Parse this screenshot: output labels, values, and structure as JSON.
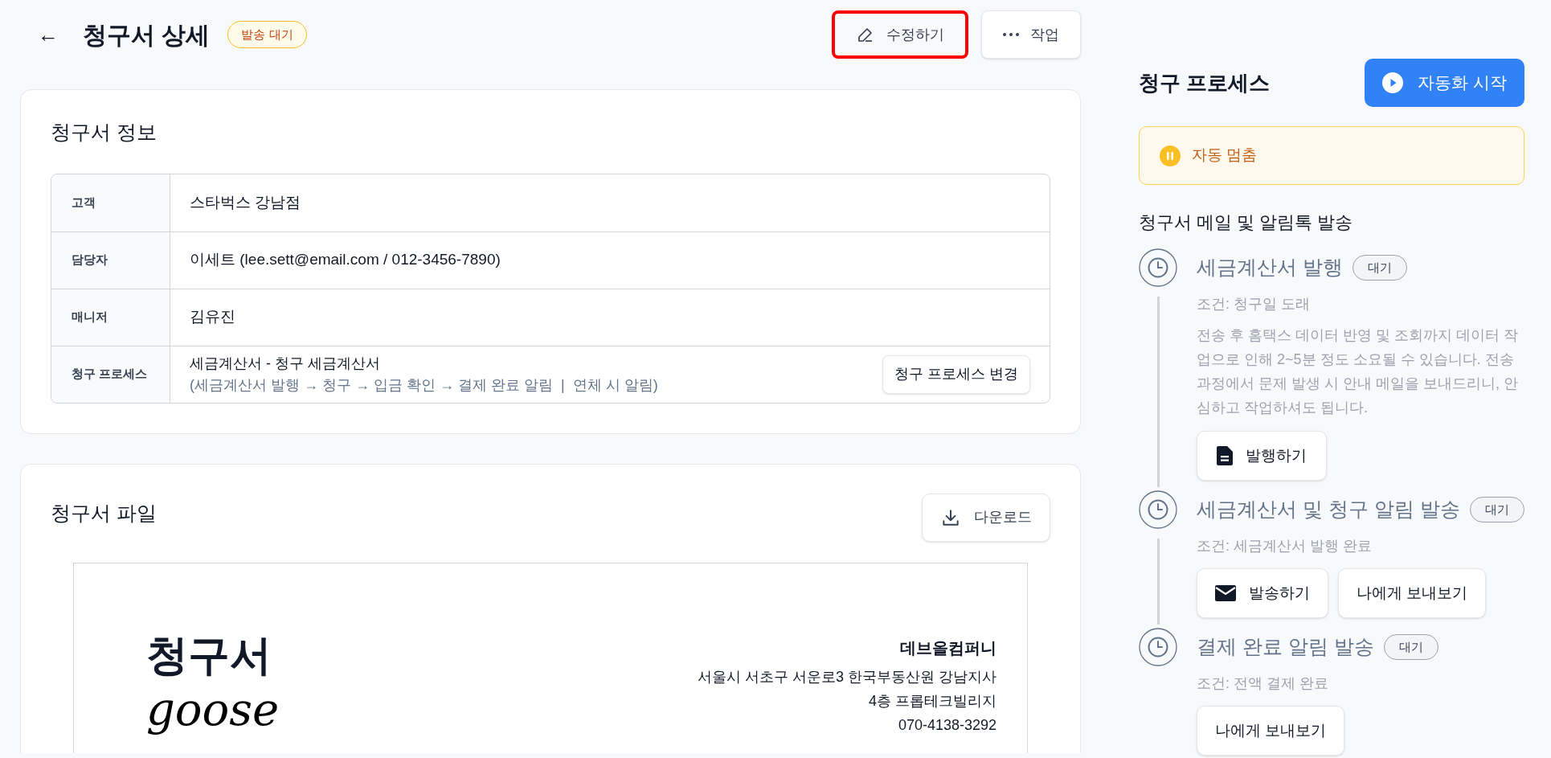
{
  "header": {
    "back": "←",
    "title": "청구서 상세",
    "status_badge": "발송 대기",
    "actions": [
      {
        "label": "수정하기",
        "kind": "edit",
        "highlighted": true
      },
      {
        "label": "작업",
        "kind": "more",
        "highlighted": false
      }
    ]
  },
  "invoice_info": {
    "title": "청구서 정보",
    "rows": [
      {
        "label": "고객",
        "value": "스타벅스 강남점"
      },
      {
        "label": "담당자",
        "value": "이세트 (lee.sett@email.com / 012-3456-7890)"
      },
      {
        "label": "매니저",
        "value": "김유진"
      },
      {
        "label": "청구 프로세스",
        "value": "세금계산서 - 청구 세금계산서",
        "detail": "(세금계산서 발행 → 청구 → 입금 확인 → 결제 완료 알림  |  연체 시 알림)",
        "button": "청구 프로세스 변경"
      }
    ]
  },
  "invoice_file": {
    "title": "청구서 파일",
    "download": "다운로드",
    "document": {
      "heading": "청구서",
      "logo": "goose",
      "company": "데브올컴퍼니",
      "address_lines": [
        "서울시 서초구 서운로3 한국부동산원 강남지사",
        "4층 프롭테크빌리지",
        "070-4138-3292"
      ]
    }
  },
  "process": {
    "title": "청구 프로세스",
    "start_button": "자동화 시작",
    "status": "자동 멈춤",
    "section_title": "청구서 메일 및 알림톡 발송",
    "steps": [
      {
        "title": "세금계산서 발행",
        "badge": "대기",
        "condition": "조건: 청구일 도래",
        "description": "전송 후 홈택스 데이터 반영 및 조회까지 데이터 작업으로 인해 2~5분 정도 소요될 수 있습니다. 전송 과정에서 문제 발생 시 안내 메일을 보내드리니, 안심하고 작업하셔도 됩니다.",
        "buttons": [
          {
            "label": "발행하기",
            "kind": "issue"
          }
        ]
      },
      {
        "title": "세금계산서 및 청구 알림 발송",
        "badge": "대기",
        "condition": "조건: 세금계산서 발행 완료",
        "buttons": [
          {
            "label": "발송하기",
            "kind": "send"
          },
          {
            "label": "나에게 보내보기",
            "kind": "test"
          }
        ]
      },
      {
        "title": "결제 완료 알림 발송",
        "badge": "대기",
        "condition": "조건: 전액 결제 완료",
        "buttons": [
          {
            "label": "나에게 보내보기",
            "kind": "test"
          }
        ]
      }
    ]
  }
}
